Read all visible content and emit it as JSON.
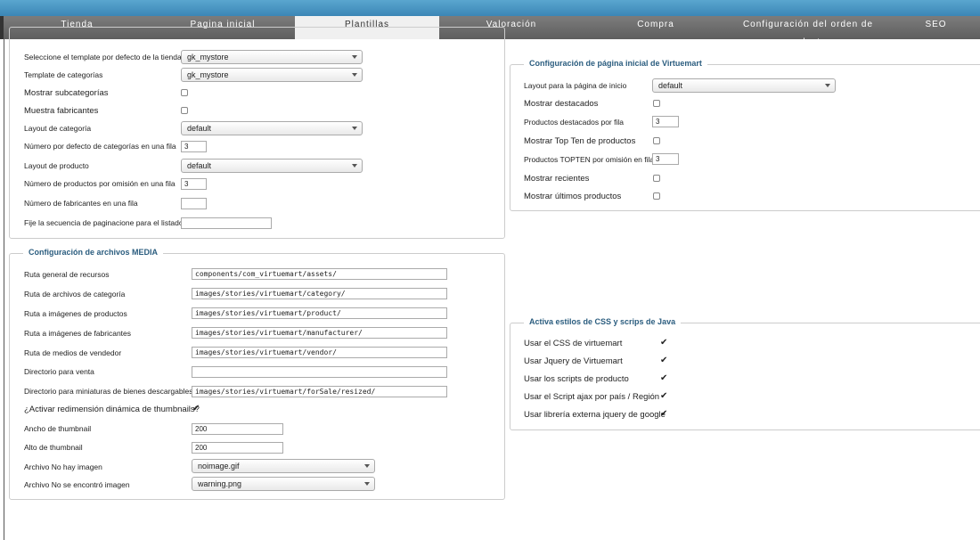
{
  "tabs": [
    {
      "label": "Tienda"
    },
    {
      "label": "Pagina inicial"
    },
    {
      "label": "Plantillas"
    },
    {
      "label": "Valoración"
    },
    {
      "label": "Compra"
    },
    {
      "label": "Configuración del orden de productos"
    },
    {
      "label": "SEO"
    }
  ],
  "templates": {
    "default_template_label": "Seleccione el template por defecto de la tienda",
    "default_template_value": "gk_mystore",
    "category_template_label": "Template de categorías",
    "category_template_value": "gk_mystore",
    "show_subcategories_label": "Mostrar subcategorías",
    "show_manufacturers_label": "Muestra fabricantes",
    "category_layout_label": "Layout de categoría",
    "category_layout_value": "default",
    "categories_per_row_label": "Número por defecto de categorías en una fila",
    "categories_per_row_value": "3",
    "product_layout_label": "Layout de producto",
    "product_layout_value": "default",
    "products_per_row_label": "Número de productos por omisión en una fila",
    "products_per_row_value": "3",
    "manufacturers_per_row_label": "Número de fabricantes en una fila",
    "manufacturers_per_row_value": "",
    "pagination_sequence_label": "Fije la secuencia de paginacione para el listado",
    "pagination_sequence_value": ""
  },
  "homepage": {
    "legend": "Configuración de página inicial de Virtuemart",
    "layout_label": "Layout para la página de inicio",
    "layout_value": "default",
    "show_featured_label": "Mostrar destacados",
    "featured_per_row_label": "Productos destacados por fila",
    "featured_per_row_value": "3",
    "show_topten_label": "Mostrar Top Ten de productos",
    "topten_per_row_label": "Productos TOPTEN por omisión en fila",
    "topten_per_row_value": "3",
    "show_recent_label": "Mostrar recientes",
    "show_latest_label": "Mostrar últimos productos"
  },
  "media": {
    "legend": "Configuración de archivos MEDIA",
    "assets_path_label": "Ruta general de recursos",
    "assets_path_value": "components/com_virtuemart/assets/",
    "category_path_label": "Ruta de archivos de categoría",
    "category_path_value": "images/stories/virtuemart/category/",
    "product_path_label": "Ruta a imágenes de productos",
    "product_path_value": "images/stories/virtuemart/product/",
    "manufacturer_path_label": "Ruta a imágenes de fabricantes",
    "manufacturer_path_value": "images/stories/virtuemart/manufacturer/",
    "vendor_path_label": "Ruta de medios de vendedor",
    "vendor_path_value": "images/stories/virtuemart/vendor/",
    "forsale_dir_label": "Directorio para venta",
    "forsale_dir_value": "",
    "forsale_thumbs_label": "Directorio para miniaturas de bienes descargables",
    "forsale_thumbs_value": "images/stories/virtuemart/forSale/resized/",
    "dynamic_resize_label": "¿Activar redimensión dinámica de thumbnails?",
    "thumb_width_label": "Ancho de thumbnail",
    "thumb_width_value": "200",
    "thumb_height_label": "Alto de thumbnail",
    "thumb_height_value": "200",
    "no_image_label": "Archivo No hay imagen",
    "no_image_value": "noimage.gif",
    "not_found_label": "Archivo No se encontró imagen",
    "not_found_value": "warning.png"
  },
  "css_js": {
    "legend": "Activa estilos de CSS y scrips de Java",
    "css_label": "Usar el CSS de virtuemart",
    "jquery_label": "Usar Jquery de Virtuemart",
    "product_scripts_label": "Usar los scripts de producto",
    "ajax_label": "Usar el Script ajax por país / Región",
    "google_jquery_label": "Usar librería externa jquery de google"
  }
}
